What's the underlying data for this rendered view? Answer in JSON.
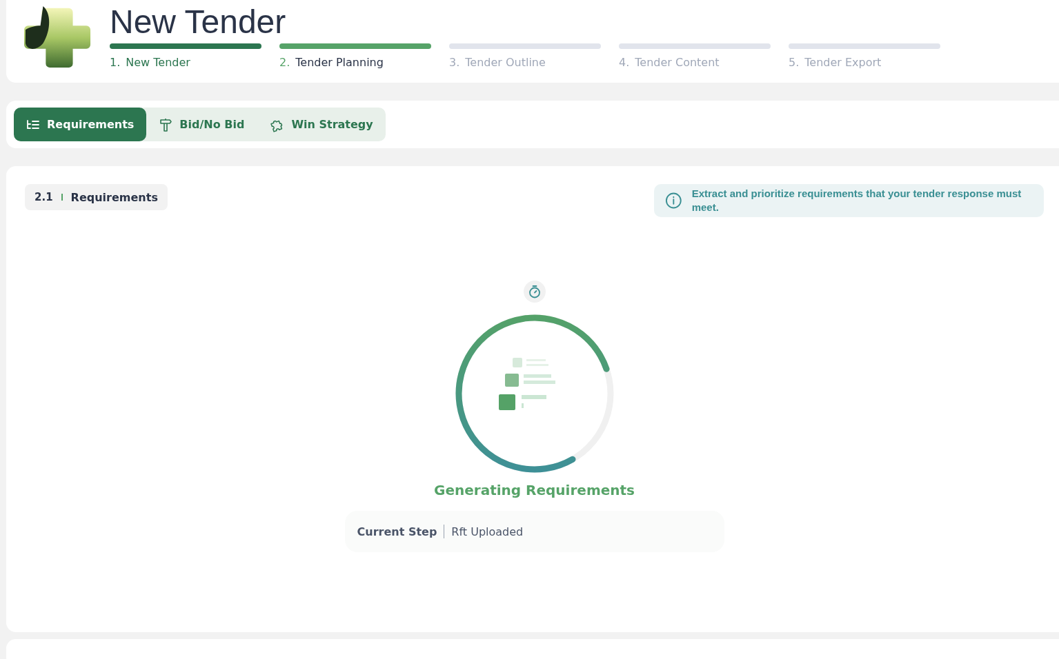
{
  "header": {
    "title": "New Tender"
  },
  "steps": [
    {
      "number": "1.",
      "label": "New Tender",
      "completed": true,
      "selected": false
    },
    {
      "number": "2.",
      "label": "Tender Planning",
      "completed": false,
      "selected": true
    },
    {
      "number": "3.",
      "label": "Tender Outline",
      "completed": false,
      "selected": false
    },
    {
      "number": "4.",
      "label": "Tender Content",
      "completed": false,
      "selected": false
    },
    {
      "number": "5.",
      "label": "Tender Export",
      "completed": false,
      "selected": false
    }
  ],
  "tabs": [
    {
      "label": "Requirements",
      "selected": true
    },
    {
      "label": "Bid/No Bid",
      "selected": false
    },
    {
      "label": "Win Strategy",
      "selected": false
    }
  ],
  "section": {
    "number": "2.1",
    "title": "Requirements"
  },
  "info": {
    "text": "Extract and prioritize requirements that your tender response must meet."
  },
  "progress": {
    "level": 0.78,
    "title": "Generating Requirements"
  },
  "current_step": {
    "label": "Current Step",
    "value": "Rft Uploaded"
  }
}
